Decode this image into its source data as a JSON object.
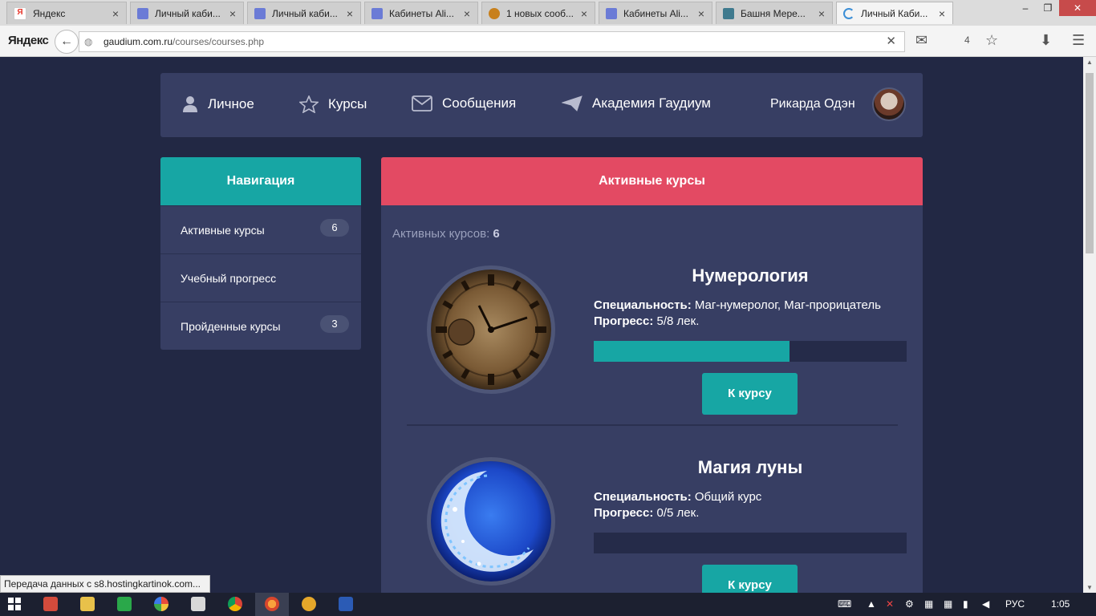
{
  "browser": {
    "tabs": [
      {
        "title": "Яндекс",
        "favicon": "yandex-icon",
        "color": "#e7352a",
        "active": false
      },
      {
        "title": "Личный каби...",
        "favicon": "crest-icon",
        "color": "#6b7bd6",
        "active": false
      },
      {
        "title": "Личный каби...",
        "favicon": "crest-icon",
        "color": "#6b7bd6",
        "active": false
      },
      {
        "title": "Кабинеты Ali...",
        "favicon": "crest-icon",
        "color": "#6b7bd6",
        "active": false
      },
      {
        "title": "1 новых сооб...",
        "favicon": "shield-icon",
        "color": "#c8801c",
        "active": false
      },
      {
        "title": "Кабинеты Ali...",
        "favicon": "crest-icon",
        "color": "#6b7bd6",
        "active": false
      },
      {
        "title": "Башня Мере...",
        "favicon": "tower-icon",
        "color": "#3f7a8e",
        "active": false
      },
      {
        "title": "Личный Каби...",
        "favicon": "loading-icon",
        "color": "#3b8ed6",
        "active": true
      }
    ],
    "logo": "Яндекс",
    "url_host": "gaudium.com.ru",
    "url_path": "/courses/courses.php",
    "bookmarks_count": "4"
  },
  "topnav": {
    "items": [
      {
        "label": "Личное",
        "icon": "user-icon"
      },
      {
        "label": "Курсы",
        "icon": "star-icon"
      },
      {
        "label": "Сообщения",
        "icon": "envelope-icon"
      },
      {
        "label": "Академия Гаудиум",
        "icon": "paper-plane-icon"
      }
    ],
    "user_name": "Рикарда Одэн"
  },
  "sidebar": {
    "title": "Навигация",
    "items": [
      {
        "label": "Активные курсы",
        "badge": "6"
      },
      {
        "label": "Учебный прогресс",
        "badge": ""
      },
      {
        "label": "Пройденные курсы",
        "badge": "3"
      }
    ]
  },
  "main": {
    "title": "Активные курсы",
    "count_label": "Активных курсов:",
    "count_value": "6",
    "specialty_label": "Специальность:",
    "progress_label": "Прогресс:",
    "button_label": "К курсу",
    "courses": [
      {
        "name": "Нумерология",
        "specialty": "Маг-нумеролог, Маг-прорицатель",
        "progress_text": "5/8 лек.",
        "progress_fraction": 0.625,
        "image": "clock-image"
      },
      {
        "name": "Магия луны",
        "specialty": "Общий курс",
        "progress_text": "0/5 лек.",
        "progress_fraction": 0,
        "image": "moon-image"
      }
    ]
  },
  "status_bar": "Передача данных с s8.hostingkartinok.com...",
  "taskbar": {
    "language": "РУС",
    "time": "1:05"
  },
  "colors": {
    "page_bg": "#222844",
    "panel": "#373e63",
    "teal": "#17a6a4",
    "pink": "#e34a63"
  }
}
